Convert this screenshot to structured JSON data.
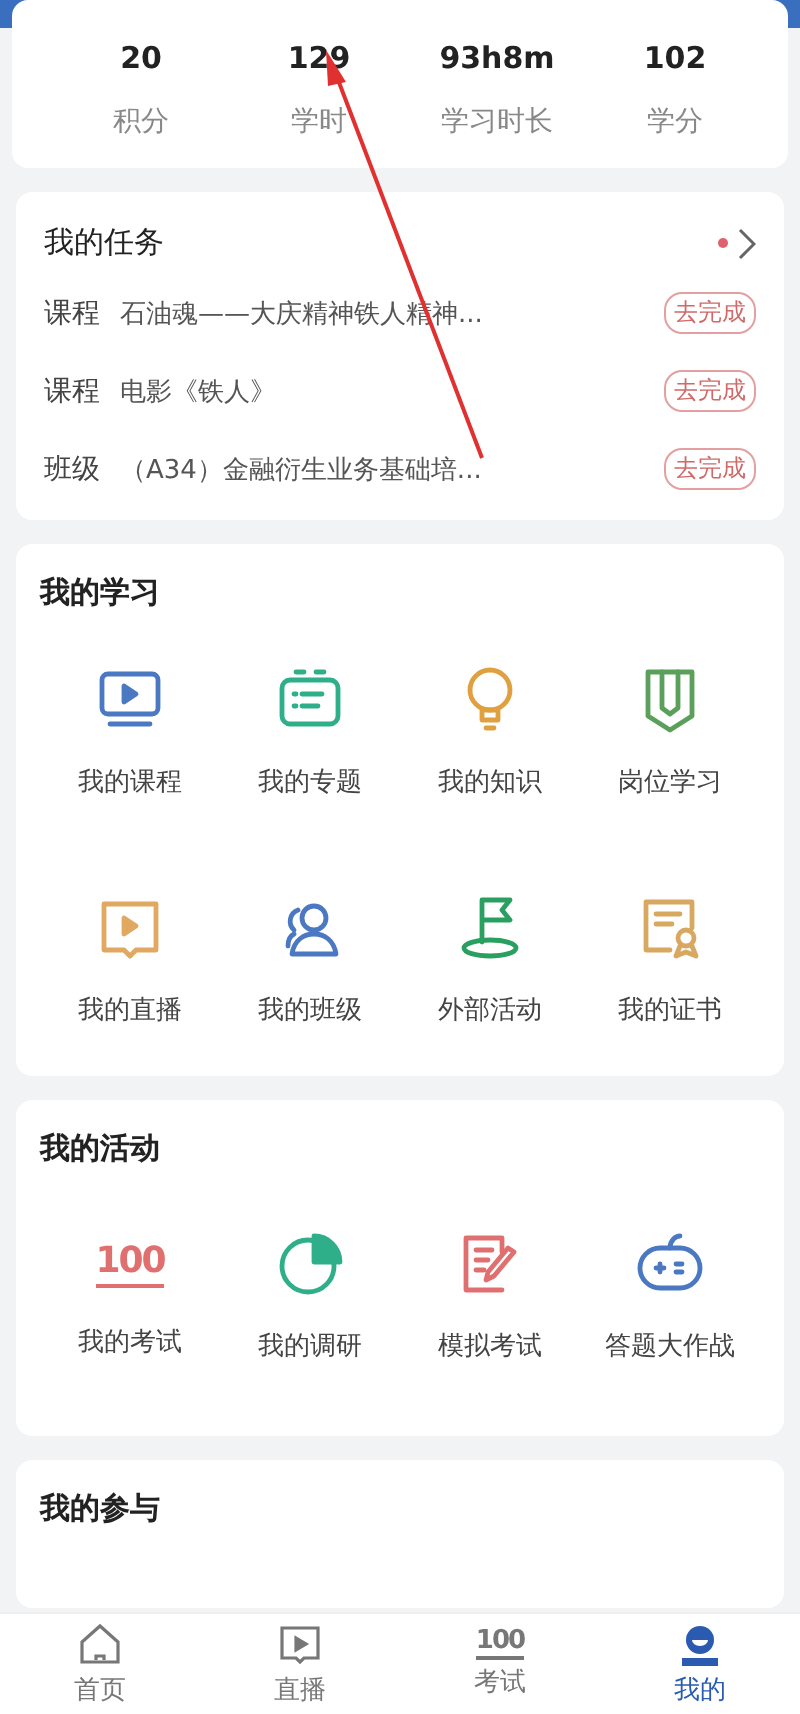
{
  "stats": [
    {
      "value": "20",
      "label": "积分"
    },
    {
      "value": "129",
      "label": "学时"
    },
    {
      "value": "93h8m",
      "label": "学习时长"
    },
    {
      "value": "102",
      "label": "学分"
    }
  ],
  "tasks": {
    "title": "我的任务",
    "has_new": true,
    "items": [
      {
        "type": "课程",
        "name": "石油魂——大庆精神铁人精神...",
        "action": "去完成"
      },
      {
        "type": "课程",
        "name": "电影《铁人》",
        "action": "去完成"
      },
      {
        "type": "班级",
        "name": "（A34）金融衍生业务基础培...",
        "action": "去完成"
      }
    ]
  },
  "learning": {
    "title": "我的学习",
    "items": [
      {
        "label": "我的课程",
        "color": "#4a78c2"
      },
      {
        "label": "我的专题",
        "color": "#2fae8a"
      },
      {
        "label": "我的知识",
        "color": "#e0a040"
      },
      {
        "label": "岗位学习",
        "color": "#5aa05a"
      },
      {
        "label": "我的直播",
        "color": "#e0a860"
      },
      {
        "label": "我的班级",
        "color": "#4a78c2"
      },
      {
        "label": "外部活动",
        "color": "#2aa060"
      },
      {
        "label": "我的证书",
        "color": "#d9a860"
      }
    ]
  },
  "activities": {
    "title": "我的活动",
    "items": [
      {
        "label": "我的考试",
        "color": "#e07070",
        "icon_text": "100"
      },
      {
        "label": "我的调研",
        "color": "#2fae8a"
      },
      {
        "label": "模拟考试",
        "color": "#e07070"
      },
      {
        "label": "答题大作战",
        "color": "#4a78c2"
      }
    ]
  },
  "participation": {
    "title": "我的参与"
  },
  "tabs": [
    {
      "label": "首页",
      "selected": false
    },
    {
      "label": "直播",
      "selected": false
    },
    {
      "label": "考试",
      "selected": false,
      "icon_text": "100"
    },
    {
      "label": "我的",
      "selected": true
    }
  ]
}
